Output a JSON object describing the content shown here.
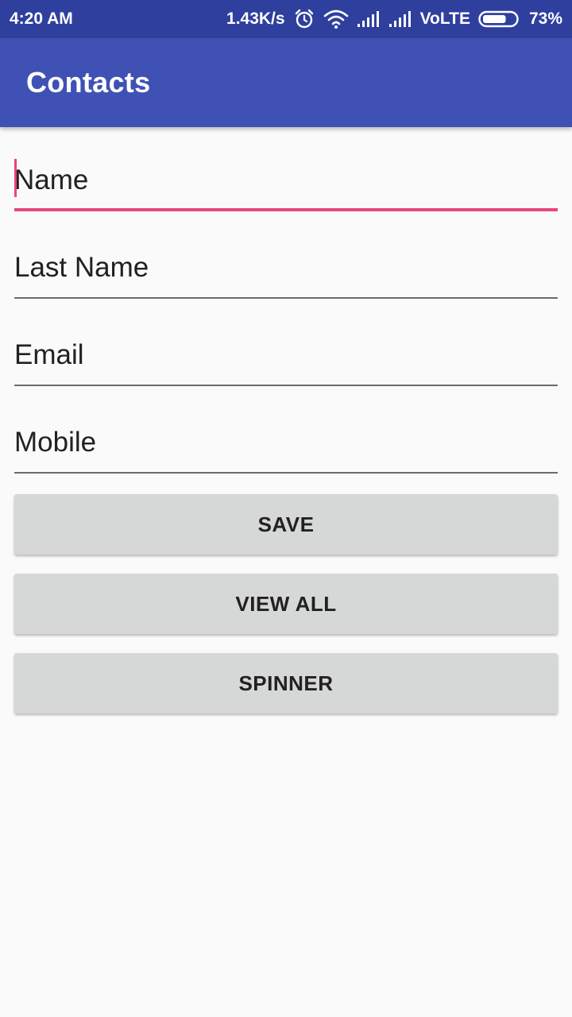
{
  "status_bar": {
    "time": "4:20 AM",
    "speed": "1.43K/s",
    "network": "VoLTE",
    "battery": "73%",
    "icons": [
      "alarm-icon",
      "wifi-icon",
      "signal-icon",
      "signal-icon",
      "battery-icon"
    ],
    "battery_level": 0.73
  },
  "app_bar": {
    "title": "Contacts"
  },
  "form": {
    "name_placeholder": "Name",
    "last_name_placeholder": "Last Name",
    "email_placeholder": "Email",
    "mobile_placeholder": "Mobile"
  },
  "buttons": {
    "save": "SAVE",
    "view_all": "VIEW ALL",
    "spinner": "SPINNER"
  },
  "colors": {
    "primary": "#3f51b5",
    "primary_dark": "#2f3f9e",
    "accent": "#e8447f"
  }
}
